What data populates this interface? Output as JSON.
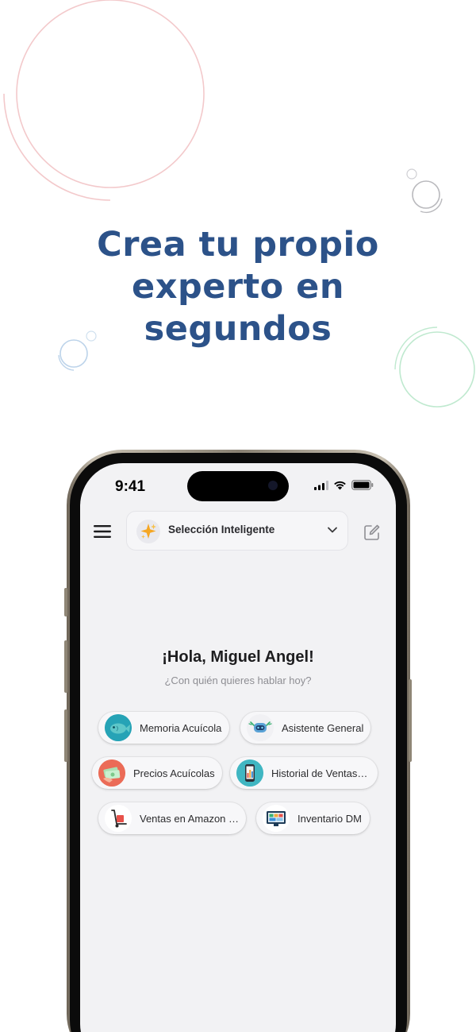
{
  "headline": {
    "lines": [
      "Crea tu propio",
      "experto en",
      "segundos"
    ],
    "color": "#2c5289"
  },
  "status_bar": {
    "time": "9:41"
  },
  "topbar": {
    "model_selector": "Selección Inteligente"
  },
  "main": {
    "greeting": "¡Hola, Miguel Angel!",
    "subtitle": "¿Con quién quieres hablar hoy?"
  },
  "experts": [
    {
      "label": "Memoria Acuícola",
      "icon": "fish-icon"
    },
    {
      "label": "Asistente General",
      "icon": "robot-icon"
    },
    {
      "label": "Precios Acuícolas",
      "icon": "money-icon"
    },
    {
      "label": "Historial de Ventas…",
      "icon": "phone-chart-icon"
    },
    {
      "label": "Ventas en Amazon …",
      "icon": "hand-truck-icon"
    },
    {
      "label": "Inventario DM",
      "icon": "monitor-dashboard-icon"
    }
  ],
  "colors": {
    "accent_blue": "#2c5289",
    "deco_pink": "#f3c9cb",
    "deco_green": "#bfe9cf",
    "deco_blue": "#bcd3ea",
    "screen_bg": "#f2f2f4"
  }
}
